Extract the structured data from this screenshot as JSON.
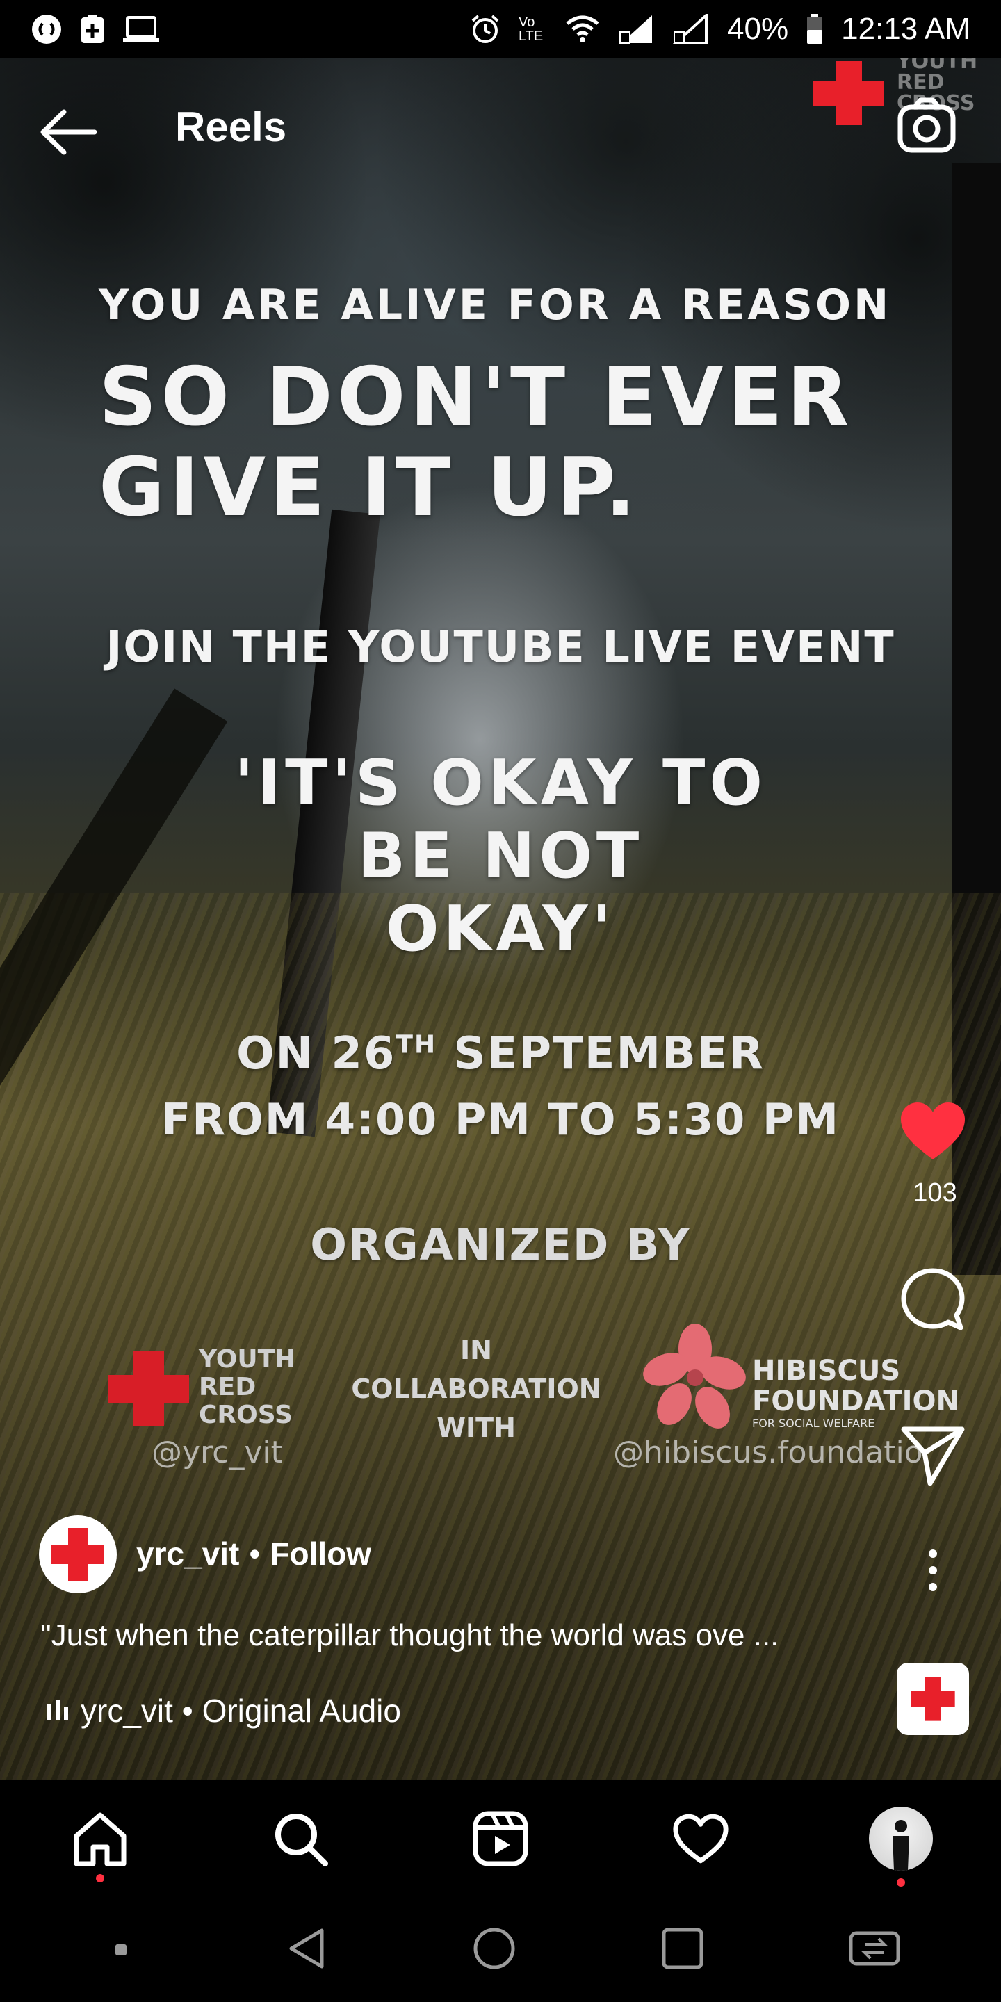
{
  "status_bar": {
    "time": "12:13 AM",
    "battery": "40%",
    "network_label": "Vo LTE"
  },
  "header": {
    "title": "Reels"
  },
  "reel_overlay": {
    "line1": "YOU ARE ALIVE FOR A REASON",
    "line2": "SO DON'T EVER",
    "line3": "GIVE IT UP.",
    "line4": "JOIN THE YOUTUBE LIVE EVENT",
    "event_line1": "'IT'S OKAY TO",
    "event_line2": "BE NOT",
    "event_line3": "OKAY'",
    "date_on": "ON",
    "date_day": "26",
    "date_sup": "TH",
    "date_month": "SEPTEMBER",
    "time_range": "FROM 4:00 PM TO 5:30 PM",
    "organized_by": "ORGANIZED BY",
    "org1_line1": "YOUTH",
    "org1_line2": "RED",
    "org1_line3": "CROSS",
    "org1_handle": "@yrc_vit",
    "collab_line1": "IN",
    "collab_line2": "COLLABORATION",
    "collab_line3": "WITH",
    "org2_line1": "HIBISCUS",
    "org2_line2": "FOUNDATION",
    "org2_tagline": "FOR SOCIAL WELFARE",
    "org2_handle": "@hibiscus.foundatio",
    "watermark_line1": "YOUTH",
    "watermark_line2": "RED",
    "watermark_line3": "CROSS"
  },
  "actions": {
    "like_count": "103"
  },
  "post": {
    "username": "yrc_vit",
    "separator": "•",
    "follow_label": "Follow",
    "caption": "\"Just when the caterpillar thought the world was ove ...",
    "audio_label": "yrc_vit • Original Audio"
  },
  "colors": {
    "accent_red": "#e8202a",
    "like_red": "#ff3040",
    "hibiscus_pink": "#e46b73"
  }
}
